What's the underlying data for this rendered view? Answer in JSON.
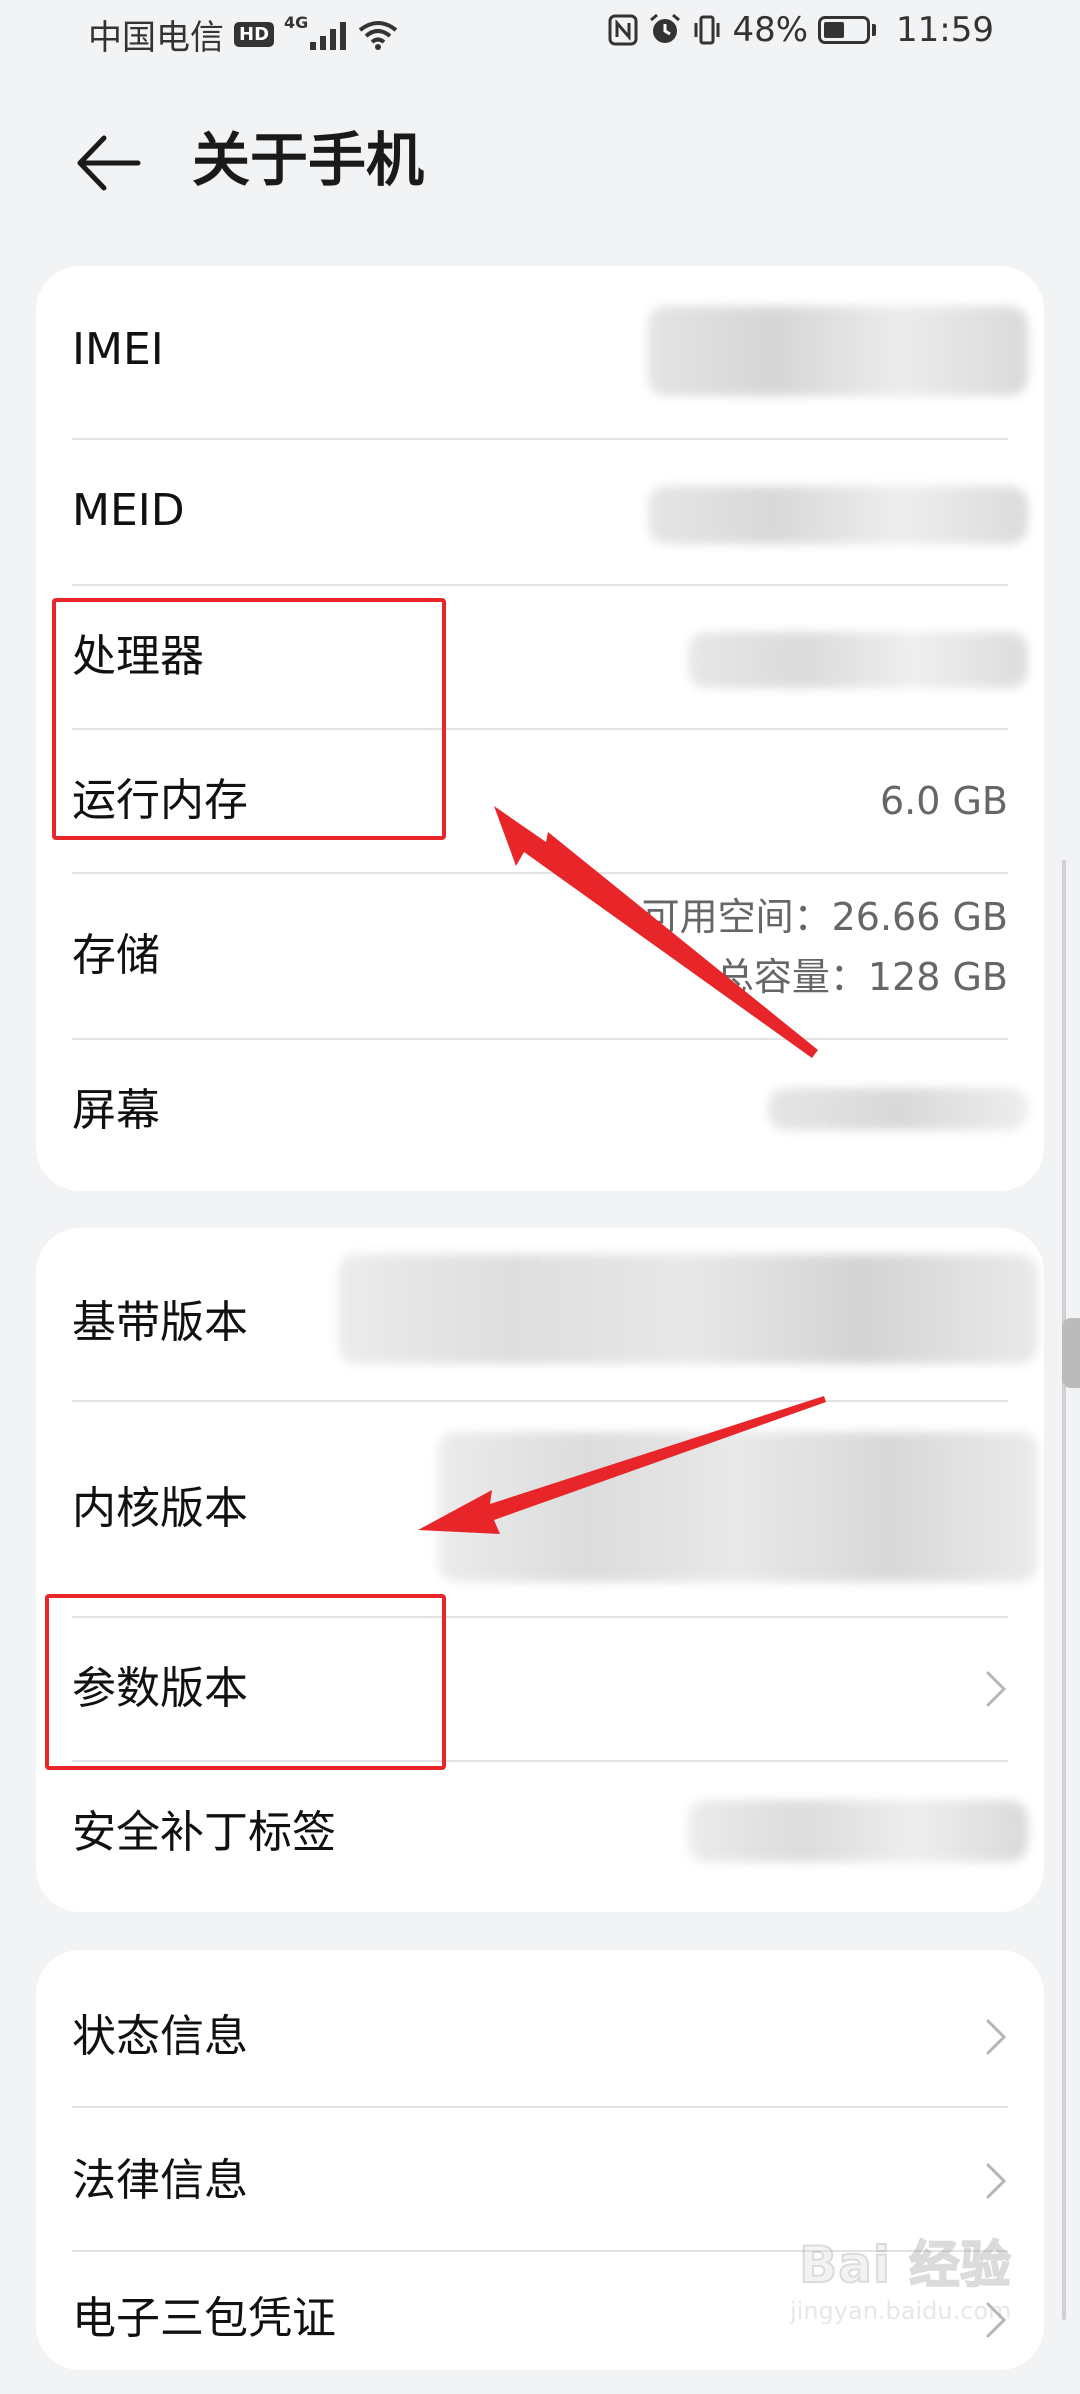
{
  "status_bar": {
    "carrier": "中国电信",
    "hd": "HD",
    "network": "4G",
    "battery_percent": "48%",
    "time": "11:59"
  },
  "header": {
    "title": "关于手机"
  },
  "card1": {
    "imei_label": "IMEI",
    "meid_label": "MEID",
    "processor_label": "处理器",
    "ram_label": "运行内存",
    "ram_value": "6.0 GB",
    "storage_label": "存储",
    "storage_available": "可用空间：26.66  GB",
    "storage_total": "总容量：128  GB",
    "screen_label": "屏幕"
  },
  "card2": {
    "baseband_label": "基带版本",
    "kernel_label": "内核版本",
    "param_label": "参数版本",
    "security_label": "安全补丁标签"
  },
  "card3": {
    "status_label": "状态信息",
    "legal_label": "法律信息",
    "warranty_label": "电子三包凭证"
  },
  "watermark": {
    "logo": "Bai 经验",
    "url": "jingyan.baidu.com"
  },
  "colors": {
    "annotation": "#e8262a",
    "card": "#ffffff",
    "background": "#f2f3f5"
  }
}
